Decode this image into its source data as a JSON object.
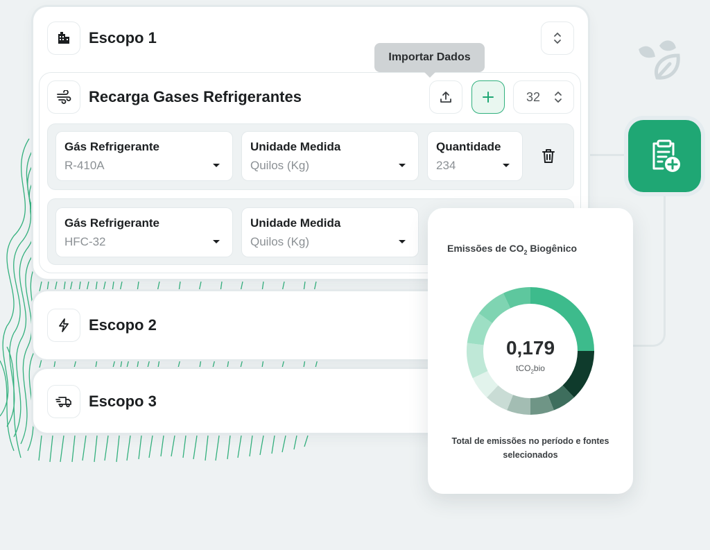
{
  "tooltip": {
    "text": "Importar Dados"
  },
  "scope1": {
    "title": "Escopo 1",
    "icon": "building-icon",
    "section": {
      "title": "Recarga Gases Refrigerantes",
      "icon": "wind-icon",
      "quantity_value": "32",
      "rows": [
        {
          "gas_label": "Gás Refrigerante",
          "gas_value": "R-410A",
          "unit_label": "Unidade Medida",
          "unit_value": "Quilos (Kg)",
          "qty_label": "Quantidade",
          "qty_value": "234"
        },
        {
          "gas_label": "Gás Refrigerante",
          "gas_value": "HFC-32",
          "unit_label": "Unidade Medida",
          "unit_value": "Quilos (Kg)"
        }
      ]
    }
  },
  "scope2": {
    "title": "Escopo 2",
    "icon": "lightning-icon"
  },
  "scope3": {
    "title": "Escopo 3",
    "icon": "truck-icon"
  },
  "stats": {
    "title_prefix": "Emissões de CO",
    "title_sub": "2",
    "title_suffix": " Biogênico",
    "value": "0,179",
    "unit_prefix": "tCO",
    "unit_sub": "2",
    "unit_suffix": "bio",
    "caption": "Total de emissões no período e fontes selecionados"
  },
  "colors": {
    "accent": "#1fa774",
    "donut_segments": [
      "#3dbb8c",
      "#0f3b2c",
      "#3e6e5d",
      "#6f9586",
      "#a3bdb3",
      "#c9dcd5",
      "#e2f3ec",
      "#bfe8d7",
      "#9ddfc4",
      "#7fd4b2",
      "#5ec79e"
    ]
  }
}
